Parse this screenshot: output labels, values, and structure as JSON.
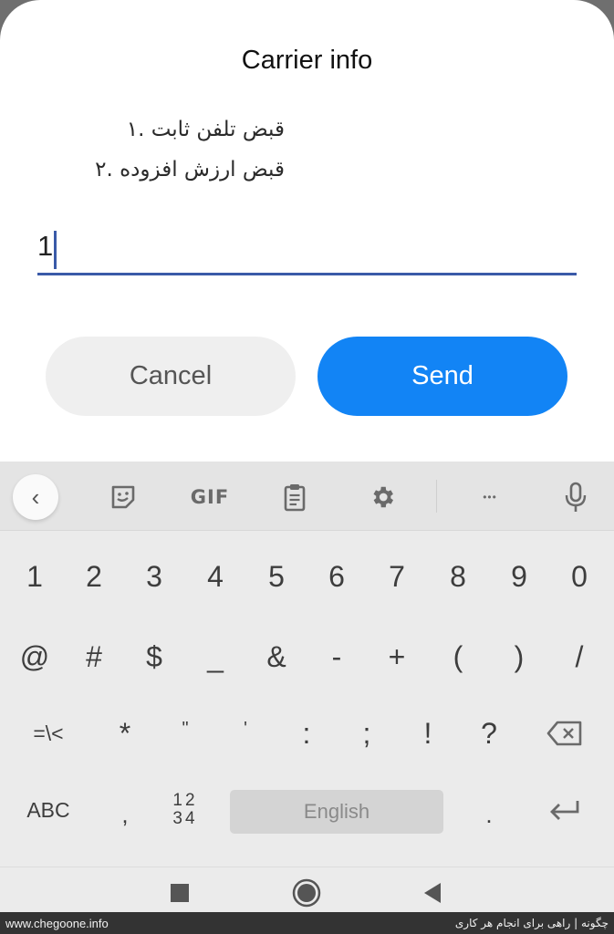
{
  "dialog": {
    "title": "Carrier info",
    "message_lines": [
      "قبض تلفن ثابت .۱",
      "قبض ارزش افزوده .۲"
    ],
    "input": {
      "value": "1"
    },
    "cancel_label": "Cancel",
    "send_label": "Send",
    "accent_color": "#1284f5"
  },
  "keyboard": {
    "toolbar": {
      "back_glyph": "‹",
      "gif_label": "GIF",
      "more_glyph": "•••"
    },
    "row1": [
      "1",
      "2",
      "3",
      "4",
      "5",
      "6",
      "7",
      "8",
      "9",
      "0"
    ],
    "row2": [
      "@",
      "#",
      "$",
      "_",
      "&",
      "-",
      "+",
      "(",
      ")",
      "/"
    ],
    "row3": [
      "=\\<",
      "*",
      "\"",
      "'",
      ":",
      ";",
      "!",
      "?"
    ],
    "row4": {
      "abc_label": "ABC",
      "comma": ",",
      "numpad_top": "12",
      "numpad_bottom": "34",
      "space_label": "English",
      "period": "."
    }
  },
  "footer": {
    "left": "www.chegoone.info",
    "right": "چگونه | راهی برای انجام هر کاری"
  }
}
